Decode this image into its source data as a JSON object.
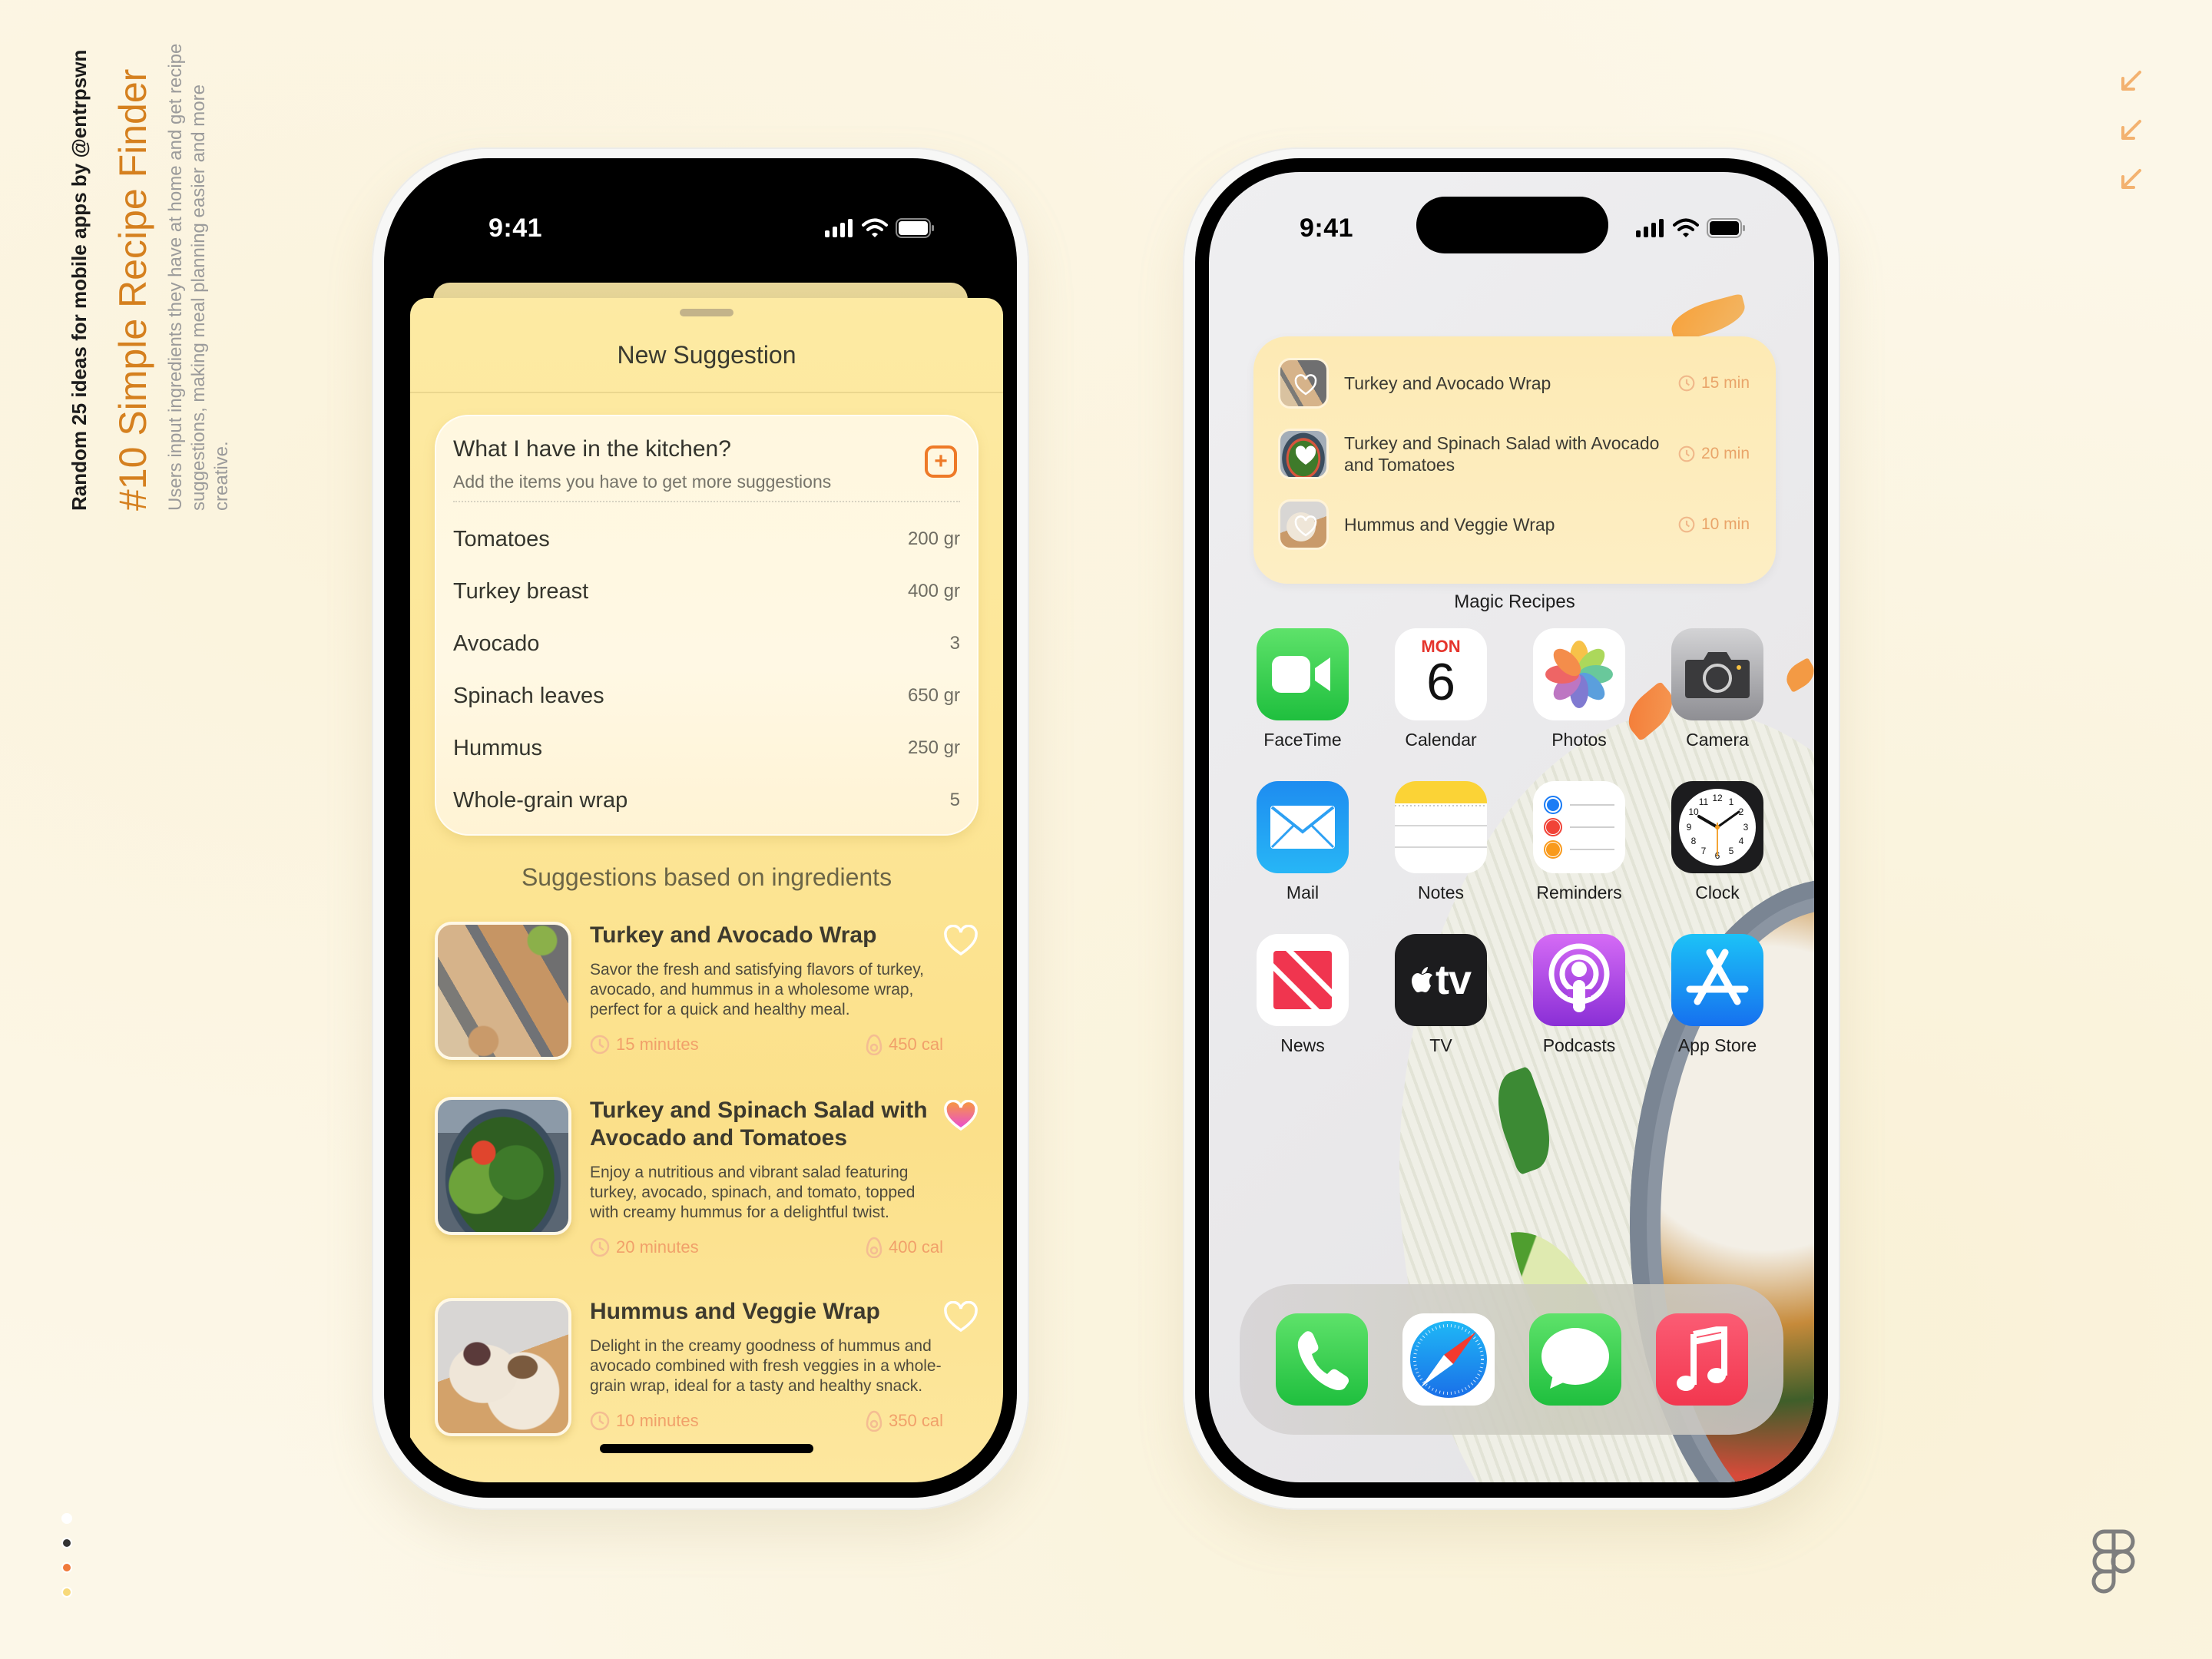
{
  "caption": {
    "series": "Random 25 ideas for mobile apps by @entrpswn",
    "title": "#10 Simple Recipe Finder",
    "description": "Users input ingredients they have at home and get recipe suggestions, making meal planning easier and more creative."
  },
  "decor": {
    "arrow_icons": [
      "arrow-down-left-icon",
      "arrow-down-left-icon",
      "arrow-down-left-icon"
    ],
    "palette_dots": [
      "#ffffff",
      "#333333",
      "#f07a3a",
      "#f7d97a"
    ],
    "logo": "figma-logo-icon"
  },
  "colors": {
    "accent": "#ee7a28",
    "meta": "#f1a06a",
    "title": "#d5801f",
    "sheet": "#fde697"
  },
  "left_phone": {
    "status_time": "9:41",
    "sheet_title": "New Suggestion",
    "kitchen": {
      "heading": "What I have in the kitchen?",
      "subheading": "Add the items you have to get more suggestions",
      "add_icon": "plus-square-icon",
      "items": [
        {
          "name": "Tomatoes",
          "qty": "200 gr"
        },
        {
          "name": "Turkey breast",
          "qty": "400 gr"
        },
        {
          "name": "Avocado",
          "qty": "3"
        },
        {
          "name": "Spinach leaves",
          "qty": "650 gr"
        },
        {
          "name": "Hummus",
          "qty": "250 gr"
        },
        {
          "name": "Whole-grain wrap",
          "qty": "5"
        }
      ]
    },
    "suggestions_title": "Suggestions based on ingredients",
    "recipes": [
      {
        "title": "Turkey and Avocado Wrap",
        "description": "Savor the fresh and satisfying flavors of turkey, avocado, and hummus in a wholesome wrap, perfect for a quick and healthy meal.",
        "time": "15 minutes",
        "calories": "450 cal",
        "favorite": false
      },
      {
        "title": "Turkey and Spinach Salad with Avocado and Tomatoes",
        "description": "Enjoy a nutritious and vibrant salad featuring turkey, avocado, spinach, and tomato, topped with creamy hummus for a delightful twist.",
        "time": "20 minutes",
        "calories": "400 cal",
        "favorite": true
      },
      {
        "title": "Hummus and Veggie Wrap",
        "description": "Delight in the creamy goodness of hummus and avocado combined with fresh veggies in a whole-grain wrap, ideal for a tasty and healthy snack.",
        "time": "10 minutes",
        "calories": "350 cal",
        "favorite": false
      }
    ]
  },
  "right_phone": {
    "status_time": "9:41",
    "widget": {
      "label": "Magic Recipes",
      "items": [
        {
          "name": "Turkey and Avocado Wrap",
          "time": "15 min"
        },
        {
          "name": "Turkey and Spinach Salad with Avocado and Tomatoes",
          "time": "20 min"
        },
        {
          "name": "Hummus and Veggie Wrap",
          "time": "10 min"
        }
      ]
    },
    "calendar": {
      "day": "MON",
      "date": "6"
    },
    "apps": [
      {
        "label": "FaceTime",
        "icon": "facetime-icon"
      },
      {
        "label": "Calendar",
        "icon": "calendar-icon"
      },
      {
        "label": "Photos",
        "icon": "photos-icon"
      },
      {
        "label": "Camera",
        "icon": "camera-icon"
      },
      {
        "label": "Mail",
        "icon": "mail-icon"
      },
      {
        "label": "Notes",
        "icon": "notes-icon"
      },
      {
        "label": "Reminders",
        "icon": "reminders-icon"
      },
      {
        "label": "Clock",
        "icon": "clock-icon"
      },
      {
        "label": "News",
        "icon": "news-icon"
      },
      {
        "label": "TV",
        "icon": "tv-icon"
      },
      {
        "label": "Podcasts",
        "icon": "podcasts-icon"
      },
      {
        "label": "App Store",
        "icon": "app-store-icon"
      }
    ],
    "tv_glyph": "tv",
    "dock": [
      {
        "name": "Phone",
        "icon": "phone-icon"
      },
      {
        "name": "Safari",
        "icon": "safari-icon"
      },
      {
        "name": "Messages",
        "icon": "messages-icon"
      },
      {
        "name": "Music",
        "icon": "music-icon"
      }
    ]
  }
}
